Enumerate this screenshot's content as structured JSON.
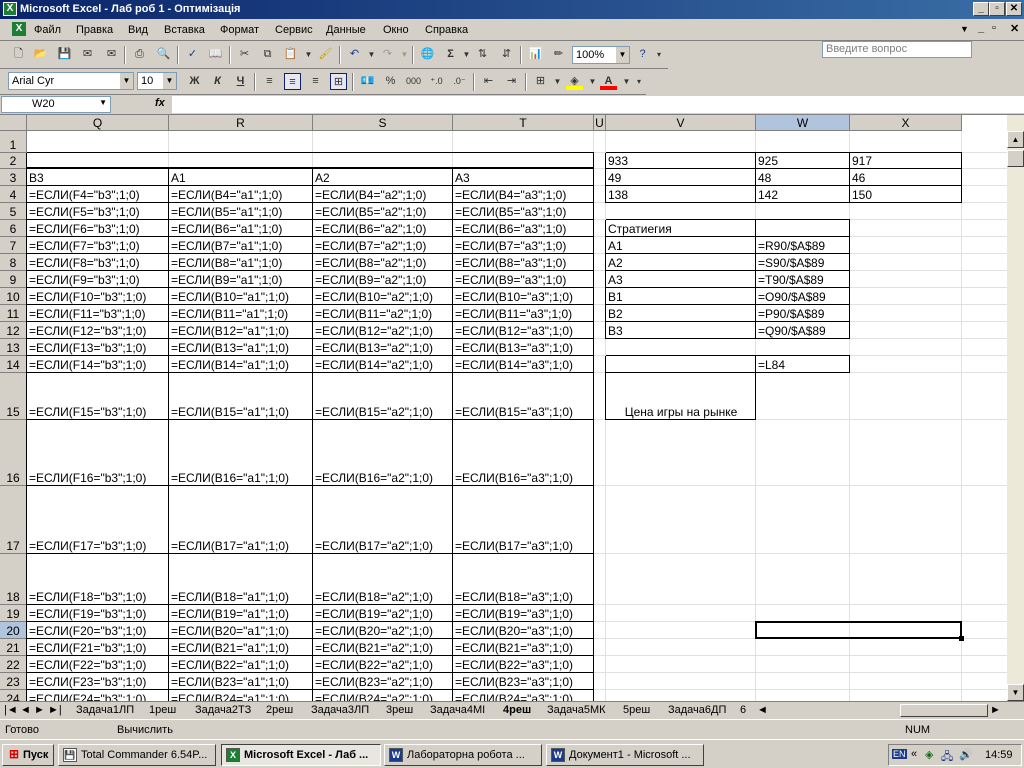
{
  "window": {
    "title": "Microsoft Excel - Лаб роб 1 - Оптимізація",
    "controls": [
      "_",
      "▫",
      "✕"
    ],
    "doc_controls": [
      "_",
      "▫",
      "✕"
    ]
  },
  "menu": {
    "items": [
      "Файл",
      "Правка",
      "Вид",
      "Вставка",
      "Формат",
      "Сервис",
      "Данные",
      "Окно",
      "Справка"
    ],
    "help_placeholder": "Введите вопрос"
  },
  "toolbar": {
    "zoom": "100%",
    "font": "Arial Cyr",
    "size": "10",
    "bold": "Ж",
    "italic": "К",
    "underline": "Ч",
    "percent": "%",
    "thousands": "000",
    "sigma": "Σ"
  },
  "formula_bar": {
    "name_box": "W20",
    "fx_label": "fx",
    "content": ""
  },
  "columns": [
    "Q",
    "R",
    "S",
    "T",
    "U",
    "V",
    "W",
    "X"
  ],
  "rows": [
    "1",
    "2",
    "3",
    "4",
    "5",
    "6",
    "7",
    "8",
    "9",
    "10",
    "11",
    "12",
    "13",
    "14",
    "15",
    "16",
    "17",
    "18",
    "19",
    "20",
    "21",
    "22",
    "23",
    "24"
  ],
  "cells": {
    "Q3": "B3",
    "R3": "A1",
    "S3": "A2",
    "T3": "A3",
    "Q4": "=ЕСЛИ(F4=\"b3\";1;0)",
    "R4": "=ЕСЛИ(B4=\"a1\";1;0)",
    "S4": "=ЕСЛИ(B4=\"a2\";1;0)",
    "T4": "=ЕСЛИ(B4=\"a3\";1;0)",
    "Q5": "=ЕСЛИ(F5=\"b3\";1;0)",
    "R5": "=ЕСЛИ(B5=\"a1\";1;0)",
    "S5": "=ЕСЛИ(B5=\"a2\";1;0)",
    "T5": "=ЕСЛИ(B5=\"a3\";1;0)",
    "Q6": "=ЕСЛИ(F6=\"b3\";1;0)",
    "R6": "=ЕСЛИ(B6=\"a1\";1;0)",
    "S6": "=ЕСЛИ(B6=\"a2\";1;0)",
    "T6": "=ЕСЛИ(B6=\"a3\";1;0)",
    "Q7": "=ЕСЛИ(F7=\"b3\";1;0)",
    "R7": "=ЕСЛИ(B7=\"a1\";1;0)",
    "S7": "=ЕСЛИ(B7=\"a2\";1;0)",
    "T7": "=ЕСЛИ(B7=\"a3\";1;0)",
    "Q8": "=ЕСЛИ(F8=\"b3\";1;0)",
    "R8": "=ЕСЛИ(B8=\"a1\";1;0)",
    "S8": "=ЕСЛИ(B8=\"a2\";1;0)",
    "T8": "=ЕСЛИ(B8=\"a3\";1;0)",
    "Q9": "=ЕСЛИ(F9=\"b3\";1;0)",
    "R9": "=ЕСЛИ(B9=\"a1\";1;0)",
    "S9": "=ЕСЛИ(B9=\"a2\";1;0)",
    "T9": "=ЕСЛИ(B9=\"a3\";1;0)",
    "Q10": "=ЕСЛИ(F10=\"b3\";1;0)",
    "R10": "=ЕСЛИ(B10=\"a1\";1;0)",
    "S10": "=ЕСЛИ(B10=\"a2\";1;0)",
    "T10": "=ЕСЛИ(B10=\"a3\";1;0)",
    "Q11": "=ЕСЛИ(F11=\"b3\";1;0)",
    "R11": "=ЕСЛИ(B11=\"a1\";1;0)",
    "S11": "=ЕСЛИ(B11=\"a2\";1;0)",
    "T11": "=ЕСЛИ(B11=\"a3\";1;0)",
    "Q12": "=ЕСЛИ(F12=\"b3\";1;0)",
    "R12": "=ЕСЛИ(B12=\"a1\";1;0)",
    "S12": "=ЕСЛИ(B12=\"a2\";1;0)",
    "T12": "=ЕСЛИ(B12=\"a3\";1;0)",
    "Q13": "=ЕСЛИ(F13=\"b3\";1;0)",
    "R13": "=ЕСЛИ(B13=\"a1\";1;0)",
    "S13": "=ЕСЛИ(B13=\"a2\";1;0)",
    "T13": "=ЕСЛИ(B13=\"a3\";1;0)",
    "Q14": "=ЕСЛИ(F14=\"b3\";1;0)",
    "R14": "=ЕСЛИ(B14=\"a1\";1;0)",
    "S14": "=ЕСЛИ(B14=\"a2\";1;0)",
    "T14": "=ЕСЛИ(B14=\"a3\";1;0)",
    "Q15": "=ЕСЛИ(F15=\"b3\";1;0)",
    "R15": "=ЕСЛИ(B15=\"a1\";1;0)",
    "S15": "=ЕСЛИ(B15=\"a2\";1;0)",
    "T15": "=ЕСЛИ(B15=\"a3\";1;0)",
    "Q16": "=ЕСЛИ(F16=\"b3\";1;0)",
    "R16": "=ЕСЛИ(B16=\"a1\";1;0)",
    "S16": "=ЕСЛИ(B16=\"a2\";1;0)",
    "T16": "=ЕСЛИ(B16=\"a3\";1;0)",
    "Q17": "=ЕСЛИ(F17=\"b3\";1;0)",
    "R17": "=ЕСЛИ(B17=\"a1\";1;0)",
    "S17": "=ЕСЛИ(B17=\"a2\";1;0)",
    "T17": "=ЕСЛИ(B17=\"a3\";1;0)",
    "Q18": "=ЕСЛИ(F18=\"b3\";1;0)",
    "R18": "=ЕСЛИ(B18=\"a1\";1;0)",
    "S18": "=ЕСЛИ(B18=\"a2\";1;0)",
    "T18": "=ЕСЛИ(B18=\"a3\";1;0)",
    "Q19": "=ЕСЛИ(F19=\"b3\";1;0)",
    "R19": "=ЕСЛИ(B19=\"a1\";1;0)",
    "S19": "=ЕСЛИ(B19=\"a2\";1;0)",
    "T19": "=ЕСЛИ(B19=\"a3\";1;0)",
    "Q20": "=ЕСЛИ(F20=\"b3\";1;0)",
    "R20": "=ЕСЛИ(B20=\"a1\";1;0)",
    "S20": "=ЕСЛИ(B20=\"a2\";1;0)",
    "T20": "=ЕСЛИ(B20=\"a3\";1;0)",
    "Q21": "=ЕСЛИ(F21=\"b3\";1;0)",
    "R21": "=ЕСЛИ(B21=\"a1\";1;0)",
    "S21": "=ЕСЛИ(B21=\"a2\";1;0)",
    "T21": "=ЕСЛИ(B21=\"a3\";1;0)",
    "Q22": "=ЕСЛИ(F22=\"b3\";1;0)",
    "R22": "=ЕСЛИ(B22=\"a1\";1;0)",
    "S22": "=ЕСЛИ(B22=\"a2\";1;0)",
    "T22": "=ЕСЛИ(B22=\"a3\";1;0)",
    "Q23": "=ЕСЛИ(F23=\"b3\";1;0)",
    "R23": "=ЕСЛИ(B23=\"a1\";1;0)",
    "S23": "=ЕСЛИ(B23=\"a2\";1;0)",
    "T23": "=ЕСЛИ(B23=\"a3\";1;0)",
    "Q24": "=ЕСЛИ(F24=\"b3\";1;0)",
    "R24": "=ЕСЛИ(B24=\"a1\";1;0)",
    "S24": "=ЕСЛИ(B24=\"a2\";1;0)",
    "T24": "=ЕСЛИ(B24=\"a3\";1;0)",
    "V2": "933",
    "W2": "925",
    "X2": "917",
    "V3": "49",
    "W3": "48",
    "X3": "46",
    "V4": "138",
    "W4": "142",
    "X4": "150",
    "V6": "Стратиегия",
    "V7": "A1",
    "W7": "=R90/$A$89",
    "V8": "A2",
    "W8": "=S90/$A$89",
    "V9": "A3",
    "W9": "=T90/$A$89",
    "V10": "B1",
    "W10": "=O90/$A$89",
    "V11": "B2",
    "W11": "=P90/$A$89",
    "V12": "B3",
    "W12": "=Q90/$A$89",
    "W14": "=L84",
    "V15": "Цена игры на рынке"
  },
  "sheet_tabs": [
    "Задача1ЛП",
    "1реш",
    "Задача2ТЗ",
    "2реш",
    "Задача3ЛП",
    "3реш",
    "Задача4МІ",
    "4реш",
    "Задача5МК",
    "5реш",
    "Задача6ДП",
    "6"
  ],
  "active_tab": "4реш",
  "status": {
    "left": "Готово",
    "mid": "Вычислить",
    "num": "NUM"
  },
  "taskbar": {
    "start": "Пуск",
    "tasks": [
      "Total Commander 6.54P...",
      "Microsoft Excel - Лаб ...",
      "Лабораторна робота ...",
      "Документ1 - Microsoft ..."
    ],
    "lang": "EN",
    "clock": "14:59"
  }
}
